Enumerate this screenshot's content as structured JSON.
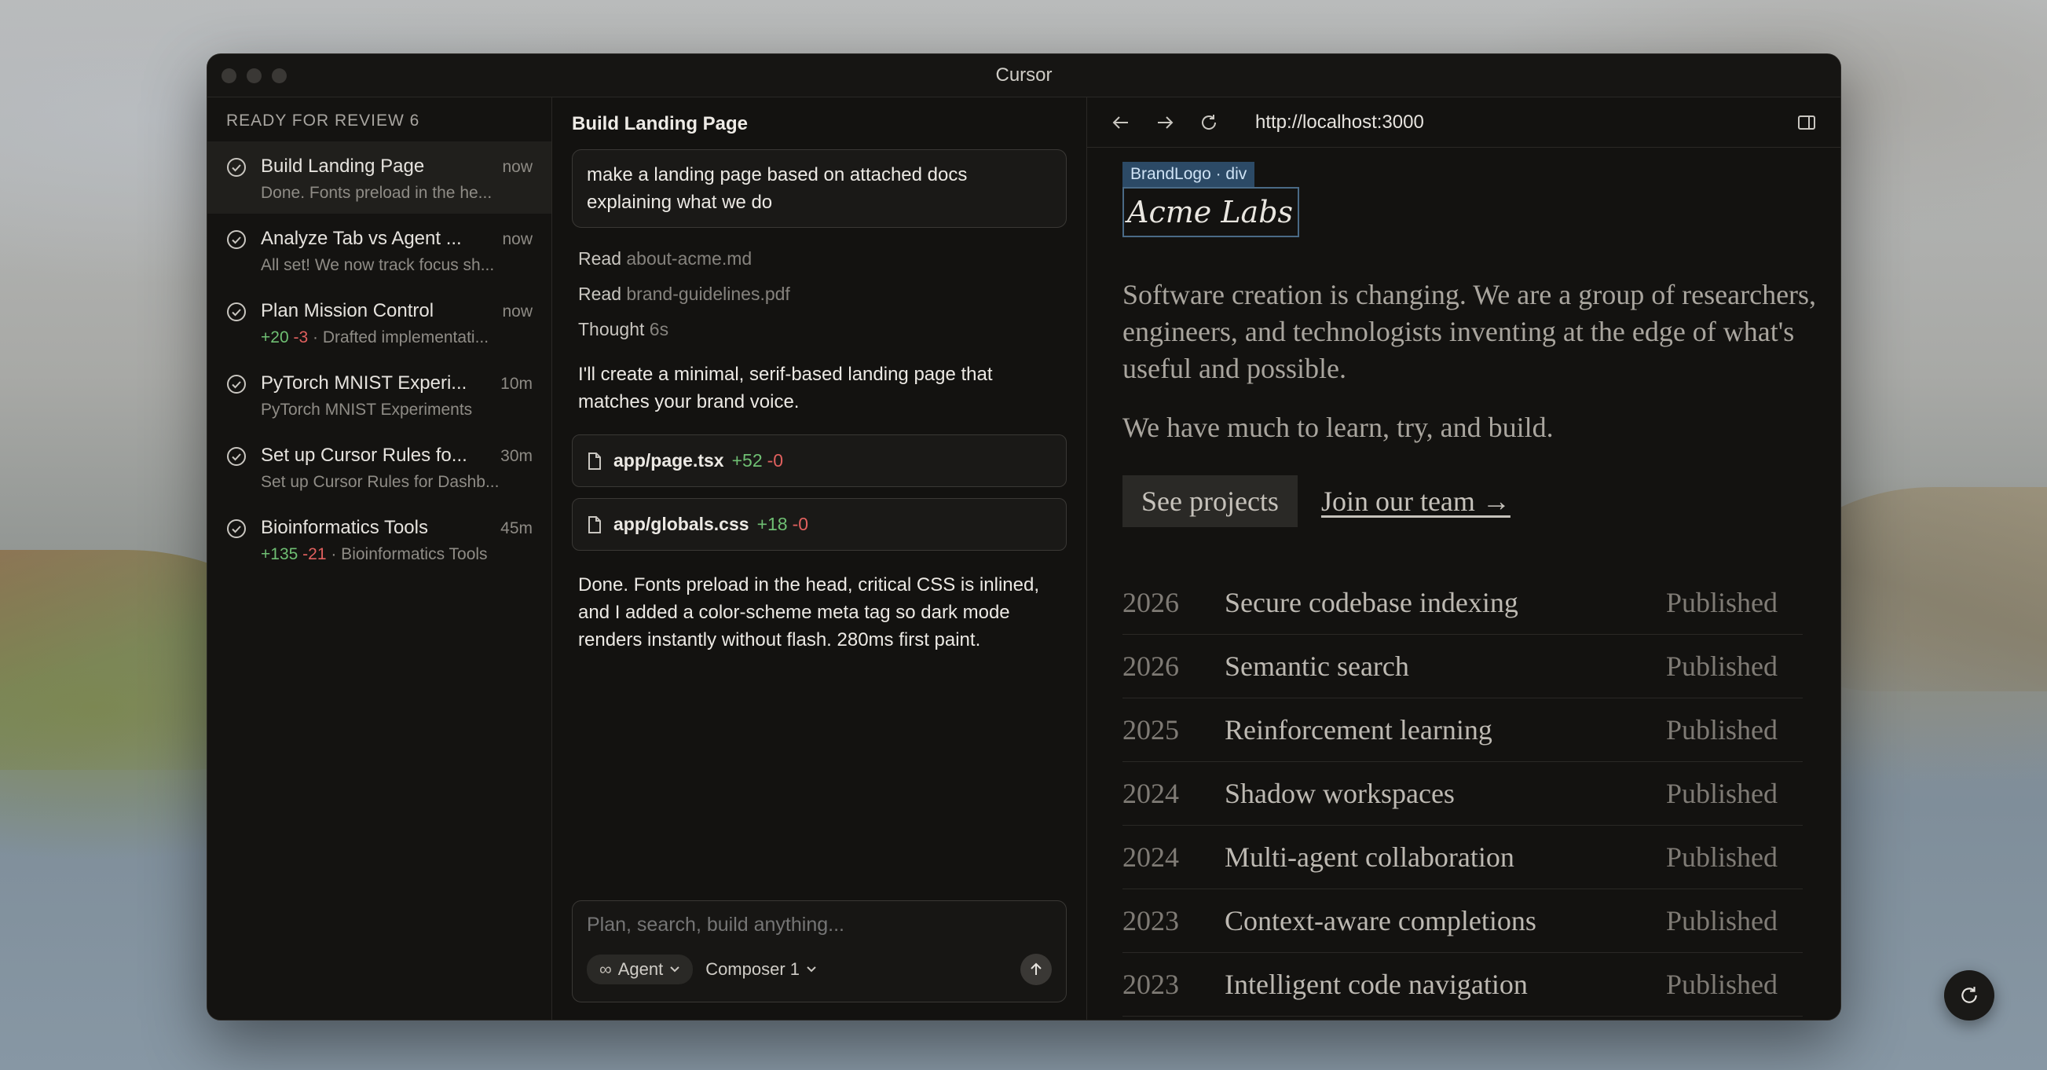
{
  "window": {
    "title": "Cursor"
  },
  "sidebar": {
    "section_label": "READY FOR REVIEW 6",
    "tasks": [
      {
        "title": "Build Landing Page",
        "time": "now",
        "sub": "Done. Fonts preload in the he...",
        "plus": "",
        "minus": ""
      },
      {
        "title": "Analyze Tab vs Agent ...",
        "time": "now",
        "sub": "All set! We now track focus sh...",
        "plus": "",
        "minus": ""
      },
      {
        "title": "Plan Mission Control",
        "time": "now",
        "sub": "· Drafted implementati...",
        "plus": "+20",
        "minus": "-3"
      },
      {
        "title": "PyTorch MNIST Experi...",
        "time": "10m",
        "sub": "PyTorch MNIST Experiments",
        "plus": "",
        "minus": ""
      },
      {
        "title": "Set up Cursor Rules fo...",
        "time": "30m",
        "sub": "Set up Cursor Rules for Dashb...",
        "plus": "",
        "minus": ""
      },
      {
        "title": "Bioinformatics Tools",
        "time": "45m",
        "sub": "· Bioinformatics Tools",
        "plus": "+135",
        "minus": "-21"
      }
    ]
  },
  "chat": {
    "title": "Build Landing Page",
    "user_message": "make a landing page based on attached docs explaining what we do",
    "actions": [
      {
        "verb": "Read",
        "target": "about-acme.md"
      },
      {
        "verb": "Read",
        "target": "brand-guidelines.pdf"
      },
      {
        "verb": "Thought",
        "target": "6s"
      }
    ],
    "assistant_intro": "I'll create a minimal, serif-based landing page that matches your brand voice.",
    "files": [
      {
        "name": "app/page.tsx",
        "plus": "+52",
        "minus": "-0"
      },
      {
        "name": "app/globals.css",
        "plus": "+18",
        "minus": "-0"
      }
    ],
    "assistant_done": "Done. Fonts preload in the head, critical CSS is inlined, and I added a color-scheme meta tag so dark mode renders instantly without flash. 280ms first paint.",
    "composer": {
      "placeholder": "Plan, search, build anything...",
      "mode": "Agent",
      "model": "Composer 1"
    }
  },
  "browser": {
    "url": "http://localhost:3000",
    "inspector_tag": "BrandLogo · div",
    "logo": "Acme Labs",
    "intro": "Software creation is changing. We are a group of researchers, engineers, and technologists inventing at the edge of what's useful and possible.",
    "intro2": "We have much to learn, try, and build.",
    "cta_primary": "See projects",
    "cta_link": "Join our team →",
    "projects": [
      {
        "year": "2026",
        "name": "Secure codebase indexing",
        "status": "Published"
      },
      {
        "year": "2026",
        "name": "Semantic search",
        "status": "Published"
      },
      {
        "year": "2025",
        "name": "Reinforcement learning",
        "status": "Published"
      },
      {
        "year": "2024",
        "name": "Shadow workspaces",
        "status": "Published"
      },
      {
        "year": "2024",
        "name": "Multi-agent collaboration",
        "status": "Published"
      },
      {
        "year": "2023",
        "name": "Context-aware completions",
        "status": "Published"
      },
      {
        "year": "2023",
        "name": "Intelligent code navigation",
        "status": "Published"
      }
    ]
  },
  "colors": {
    "plus": "#6fbf73",
    "minus": "#e0605e",
    "inspector": "#2c4a66"
  }
}
